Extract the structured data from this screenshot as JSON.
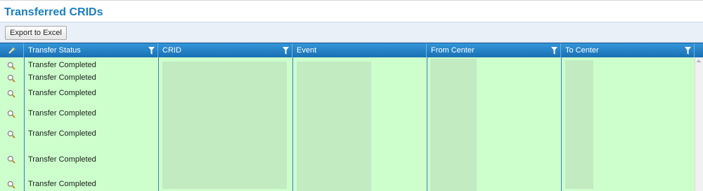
{
  "page": {
    "title": "Transferred CRIDs"
  },
  "toolbar": {
    "export_label": "Export to Excel"
  },
  "grid": {
    "columns": [
      {
        "key": "action",
        "label": ""
      },
      {
        "key": "transfer_status",
        "label": "Transfer Status"
      },
      {
        "key": "crid",
        "label": "CRID"
      },
      {
        "key": "event",
        "label": "Event"
      },
      {
        "key": "from_center",
        "label": "From Center"
      },
      {
        "key": "to_center",
        "label": "To Center"
      }
    ],
    "rows": [
      {
        "transfer_status": "Transfer Completed"
      },
      {
        "transfer_status": "Transfer Completed"
      },
      {
        "transfer_status": "Transfer Completed"
      },
      {
        "transfer_status": "Transfer Completed"
      },
      {
        "transfer_status": "Transfer Completed"
      },
      {
        "transfer_status": "Transfer Completed"
      },
      {
        "transfer_status": "Transfer Completed"
      }
    ]
  },
  "colors": {
    "accent": "#1a7fc3",
    "header": "#2283c6",
    "row_bg": "#ccffcc",
    "redaction": "#c2ebc2"
  },
  "icons": {
    "row_action": "magnifier-icon",
    "header_action": "wand-icon",
    "filter": "filter-icon"
  }
}
